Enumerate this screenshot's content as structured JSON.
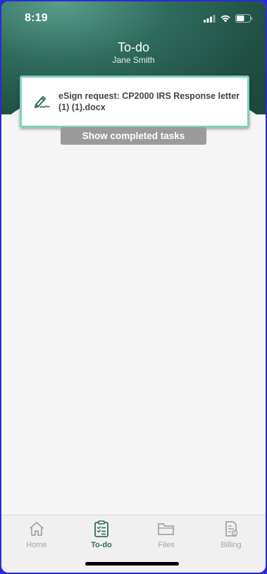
{
  "status_bar": {
    "time": "8:19",
    "icons": [
      "cellular-signal-icon",
      "wifi-icon",
      "battery-icon"
    ]
  },
  "header": {
    "title": "To-do",
    "subtitle": "Jane Smith"
  },
  "tasks": [
    {
      "icon": "signature-pen-icon",
      "text": "eSign request: CP2000 IRS Response letter (1) (1).docx"
    }
  ],
  "show_completed_label": "Show completed tasks",
  "tab_bar": {
    "tabs": [
      {
        "label": "Home",
        "icon": "home-icon",
        "active": false
      },
      {
        "label": "To-do",
        "icon": "clipboard-checklist-icon",
        "active": true
      },
      {
        "label": "Files",
        "icon": "folder-icon",
        "active": false
      },
      {
        "label": "Billing",
        "icon": "invoice-icon",
        "active": false
      }
    ]
  },
  "colors": {
    "header_dark": "#1f4e43",
    "header_light": "#5a9e8c",
    "accent": "#2f6b5d",
    "card_border": "#7fd0bd",
    "button_gray": "#9b9b9b",
    "tab_inactive": "#a5a5a5"
  }
}
